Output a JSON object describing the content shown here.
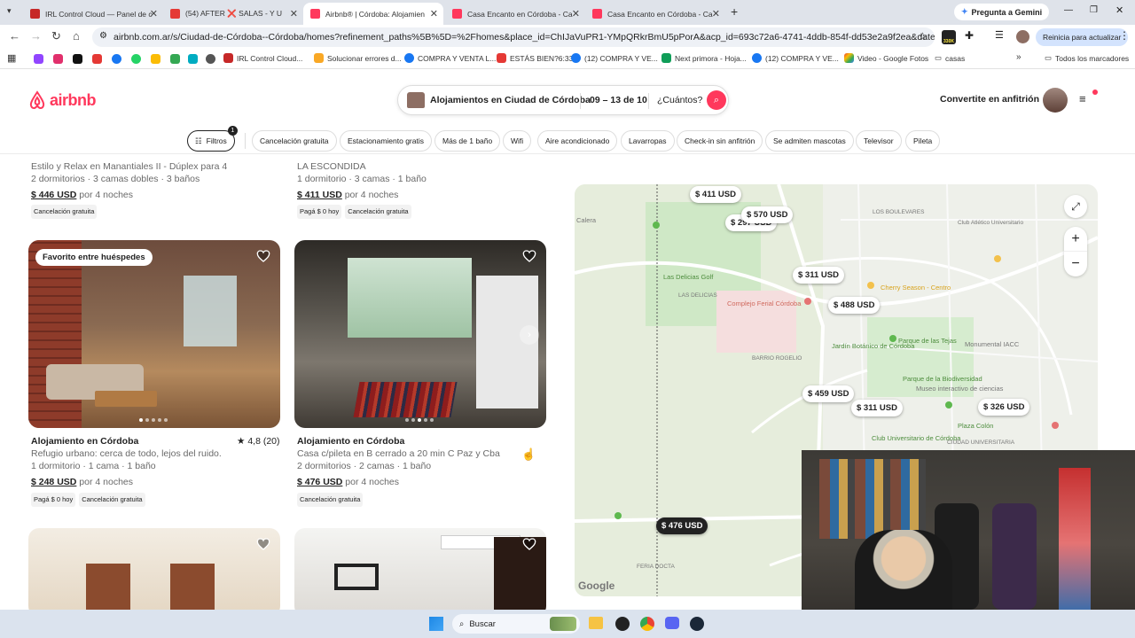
{
  "browser": {
    "tabs": [
      {
        "label": "IRL Control Cloud — Panel de c",
        "color": "#c62828"
      },
      {
        "label": "(54) AFTER ❌ SALAS - Y U",
        "color": "#e53935"
      },
      {
        "label": "Airbnb® | Córdoba: Alojamien",
        "color": "#ff385c"
      },
      {
        "label": "Casa Encanto en Córdoba - Ca",
        "color": "#ff385c"
      },
      {
        "label": "Casa Encanto en Córdoba - Ca",
        "color": "#ff385c"
      }
    ],
    "new_tab": "+",
    "gemini": "Pregunta a Gemini",
    "url": "airbnb.com.ar/s/Ciudad-de-Córdoba--Córdoba/homes?refinement_paths%5B%5D=%2Fhomes&place_id=ChIJaVuPR1-YMpQRkrBmU5pPorA&acp_id=693c72a6-4741-4ddb-854f-dd53e2a9f2ea&date_picker_type=cal...",
    "ext_badge": "330K",
    "update_label": "Reinicia para actualizar",
    "bookmarks": [
      "IRL Control Cloud...",
      "Solucionar errores d...",
      "COMPRA Y VENTA L...",
      "ESTÁS BIEN?6:33",
      "(12) COMPRA Y VE...",
      "Next primora - Hoja...",
      "(12) COMPRA Y VE...",
      "Video - Google Fotos",
      "casas"
    ],
    "all_bookmarks": "Todos los marcadores"
  },
  "header": {
    "logo": "airbnb",
    "search_location": "Alojamientos en Ciudad de Córdoba",
    "search_dates": "09 – 13 de 10",
    "search_guests": "¿Cuántos?",
    "host_link": "Convertite en anfitrión",
    "brand_color": "#ff385c"
  },
  "filters": {
    "filters_label": "Filtros",
    "filters_count": "1",
    "chips": [
      "Cancelación gratuita",
      "Estacionamiento gratis",
      "Más de 1 baño",
      "Wifi",
      "Aire acondicionado",
      "Lavarropas",
      "Check-in sin anfitrión",
      "Se admiten mascotas",
      "Televisor",
      "Pileta"
    ]
  },
  "listings_top": [
    {
      "subtitle": "Estilo y Relax en Manantiales II - Dúplex para 4",
      "details": "2 dormitorios · 3 camas dobles · 3 baños",
      "price": "$ 446 USD",
      "price_suffix": "por 4 noches",
      "tags": [
        "Cancelación gratuita"
      ]
    },
    {
      "subtitle": "LA ESCONDIDA",
      "details": "1 dormitorio · 3 camas · 1 baño",
      "price": "$ 411 USD",
      "price_suffix": "por 4 noches",
      "tags": [
        "Pagá $ 0 hoy",
        "Cancelación gratuita"
      ]
    }
  ],
  "listings": [
    {
      "badge": "Favorito entre huéspedes",
      "title": "Alojamiento en Córdoba",
      "rating": "★ 4,8 (20)",
      "subtitle": "Refugio urbano: cerca de todo, lejos del ruido.",
      "details": "1 dormitorio · 1 cama · 1 baño",
      "price": "$ 248 USD",
      "price_suffix": "por 4 noches",
      "tags": [
        "Pagá $ 0 hoy",
        "Cancelación gratuita"
      ]
    },
    {
      "badge": "",
      "title": "Alojamiento en Córdoba",
      "rating": "",
      "subtitle": "Casa c/pileta en B cerrado a 20 min C Paz y Cba",
      "details": "2 dormitorios · 2 camas · 1 baño",
      "price": "$ 476 USD",
      "price_suffix": "por 4 noches",
      "tags": [
        "Cancelación gratuita"
      ]
    }
  ],
  "map": {
    "price_pins": [
      "$ 411 USD",
      "$ 570 USD",
      "$ 297 USD",
      "$ 311 USD",
      "$ 488 USD",
      "$ 459 USD",
      "$ 311 USD",
      "$ 326 USD",
      "$ 476 USD"
    ],
    "labels": [
      "Calera",
      "LOS BOULEVARES",
      "Club Atlético Universitario",
      "Las Delicias Golf",
      "LAS DELICIAS",
      "Complejo Ferial Córdoba",
      "Cherry Season - Centro",
      "BARRIO ROGELIO",
      "Jardín Botánico de Córdoba",
      "Parque de las Tejas",
      "Monumental IACC",
      "Parque de la Biodiversidad",
      "Museo interactivo de ciencias",
      "Plaza Colón",
      "Club Universitario de Córdoba",
      "CIUDAD UNIVERSITARIA",
      "FERIA DOCTA",
      "Google"
    ],
    "google": "Google"
  },
  "taskbar": {
    "search_placeholder": "Buscar"
  }
}
